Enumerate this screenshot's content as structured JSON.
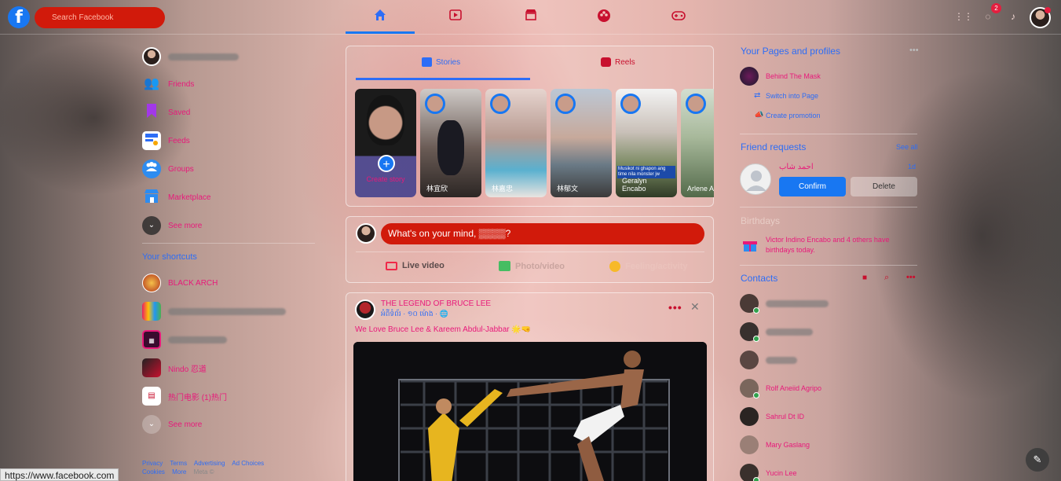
{
  "header": {
    "search_placeholder": "Search Facebook",
    "notification_count": "2",
    "nav": [
      {
        "name": "home",
        "glyph": "⌂"
      },
      {
        "name": "watch",
        "glyph": "▶"
      },
      {
        "name": "marketplace",
        "glyph": "⌂"
      },
      {
        "name": "groups",
        "glyph": "☺"
      },
      {
        "name": "gaming",
        "glyph": "◉"
      }
    ]
  },
  "sidebar": {
    "items": [
      {
        "label": "Friends"
      },
      {
        "label": "Saved"
      },
      {
        "label": "Feeds"
      },
      {
        "label": "Groups"
      },
      {
        "label": "Marketplace"
      },
      {
        "label": "See more"
      }
    ],
    "shortcuts_title": "Your shortcuts",
    "shortcuts": [
      {
        "label": "BLACK ARCH"
      },
      {
        "label": ""
      },
      {
        "label": ""
      },
      {
        "label": "Nindo 忍道"
      },
      {
        "label": "热门电影 (1)热门"
      }
    ],
    "see_more_2": "See more",
    "footer": [
      "Privacy",
      "Terms",
      "Advertising",
      "Ad Choices",
      "Cookies",
      "More",
      "Meta ©"
    ]
  },
  "status_url": "https://www.facebook.com",
  "stories": {
    "tab_stories": "Stories",
    "tab_reels": "Reels",
    "create_label": "Create story",
    "items": [
      {
        "name": "林宜欣"
      },
      {
        "name": "林嘉忠"
      },
      {
        "name": "林郁文"
      },
      {
        "name": "Geralyn Encabo"
      },
      {
        "name": "Arlene Abrenil"
      }
    ],
    "caption_overlay": "Musikot ni ghapon ang time nila monster jw"
  },
  "composer": {
    "prompt": "What's on your mind, ▒▒▒▒?",
    "actions": [
      {
        "label": "Live video"
      },
      {
        "label": "Photo/video"
      },
      {
        "label": "Feeling/activity"
      }
    ]
  },
  "post": {
    "page_name": "THE LEGEND OF BRUCE LEE",
    "meta": "អំពីទំព័រ · ១០ ម៉ោង · 🌐",
    "text": "We Love Bruce Lee & Kareem Abdul-Jabbar 🌟🤜"
  },
  "right": {
    "pages_title": "Your Pages and profiles",
    "page_name": "Behind The Mask",
    "switch_label": "Switch into Page",
    "promo_label": "Create promotion",
    "friend_requests_title": "Friend requests",
    "see_all": "See all",
    "requester": "احمد شاب",
    "request_time": "1d",
    "confirm_label": "Confirm",
    "delete_label": "Delete",
    "birthdays_title": "Birthdays",
    "birthday_text": "Victor Indino Encabo and 4 others have birthdays today.",
    "contacts_title": "Contacts",
    "contacts": [
      {
        "name": ""
      },
      {
        "name": ""
      },
      {
        "name": ""
      },
      {
        "name": "Rolf Aneiid Agripo"
      },
      {
        "name": "Sahrul Dt ID"
      },
      {
        "name": "Mary Gaslang"
      },
      {
        "name": "Yucin Lee"
      }
    ]
  },
  "colors": {
    "accent_blue": "#1877f2",
    "label_pink": "#e8197a",
    "search_red": "#d11a0b"
  }
}
